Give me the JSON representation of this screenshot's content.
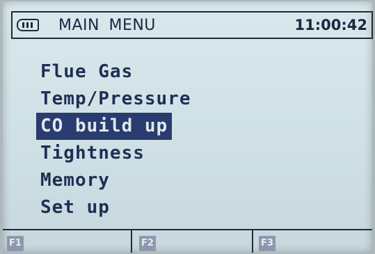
{
  "header": {
    "title": "MAIN  MENU",
    "time": "11:00:42",
    "battery_icon": "battery-icon"
  },
  "menu": {
    "items": [
      {
        "label": "Flue Gas",
        "selected": false
      },
      {
        "label": "Temp/Pressure",
        "selected": false
      },
      {
        "label": "CO build up",
        "selected": true
      },
      {
        "label": "Tightness",
        "selected": false
      },
      {
        "label": "Memory",
        "selected": false
      },
      {
        "label": "Set up",
        "selected": false
      }
    ]
  },
  "function_keys": [
    {
      "label": "F1"
    },
    {
      "label": "F2"
    },
    {
      "label": "F3"
    }
  ],
  "colors": {
    "screen": "#d4e4e9",
    "text": "#1f2e54",
    "highlight": "#2a3b6e",
    "highlight_text": "#dfe9ee"
  }
}
